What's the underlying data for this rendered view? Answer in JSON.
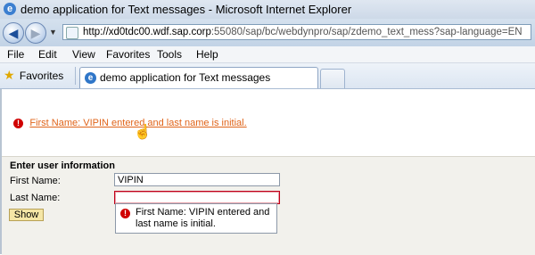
{
  "window": {
    "title": "demo application for Text messages - Microsoft Internet Explorer",
    "logo_letter": "e"
  },
  "nav": {
    "back_glyph": "◀",
    "forward_glyph": "▶",
    "dropdown_glyph": "▼",
    "url_host": "http://xd0tdc00.wdf.sap.corp",
    "url_rest": ":55080/sap/bc/webdynpro/sap/zdemo_text_mess?sap-language=EN"
  },
  "menu": [
    "File",
    "Edit",
    "View",
    "Favorites",
    "Tools",
    "Help"
  ],
  "favorites": {
    "label": "Favorites",
    "star_glyph": "★"
  },
  "tabs": {
    "active_label": "demo application for Text messages",
    "icon_letter": "e"
  },
  "message": {
    "icon_glyph": "!",
    "text": "First Name: VIPIN entered and last name is initial.",
    "color": "#e0641a"
  },
  "cursor_glyph": "☝",
  "form": {
    "section_title": "Enter user information",
    "first_name_label": "First Name:",
    "first_name_value": "VIPIN",
    "last_name_label": "Last Name:",
    "last_name_value": "",
    "show_label": "Show"
  },
  "tooltip": {
    "icon_glyph": "!",
    "text": "First Name: VIPIN entered and last name is initial."
  },
  "colors": {
    "error_red": "#d00000",
    "button_bg": "#f5e6a6",
    "form_bg": "#f2f1ec"
  }
}
